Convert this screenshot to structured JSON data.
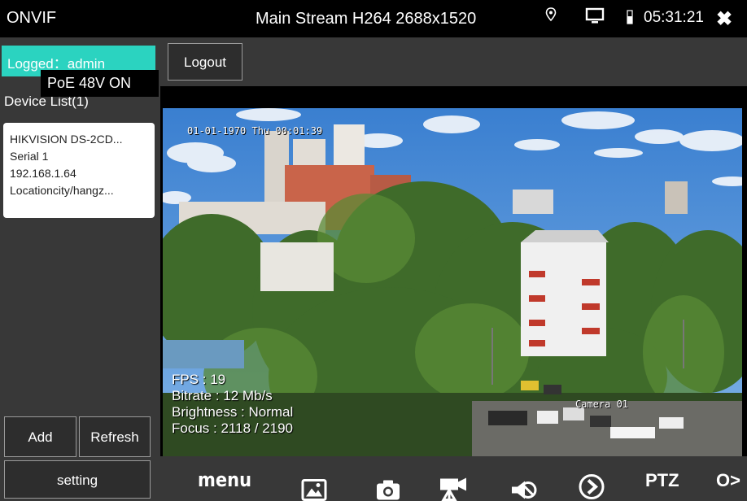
{
  "statusbar": {
    "app_title": "ONVIF",
    "stream_title": "Main Stream H264 2688x1520",
    "time": "05:31:21",
    "close_glyph": "✖",
    "icons": [
      "location-icon",
      "monitor-icon",
      "battery-icon"
    ]
  },
  "sidebar": {
    "logged": "Logged：admin",
    "poe": "PoE 48V ON",
    "device_list_header": "Device List(1)",
    "device": {
      "name": "HIKVISION DS-2CD...",
      "serial": "Serial 1",
      "ip": "192.168.1.64",
      "location": "Locationcity/hangz..."
    },
    "add_label": "Add",
    "refresh_label": "Refresh",
    "setting_label": "setting"
  },
  "mainbar": {
    "logout_label": "Logout"
  },
  "video": {
    "osd_time": "01-01-1970 Thu 00:01:39",
    "osd_camera": "Camera 01",
    "fps": "FPS : 19",
    "bitrate": "Bitrate : 12 Mb/s",
    "brightness": "Brightness : Normal",
    "focus": "Focus : 2118 / 2190"
  },
  "toolbar": {
    "menu_label": "menu",
    "ptz_label": "PTZ",
    "more_label": "O>",
    "icons": [
      "image-icon",
      "camera-icon",
      "video-record-icon",
      "mute-icon",
      "play-icon"
    ]
  },
  "colors": {
    "accent": "#2bd3c0",
    "panel": "#383838",
    "background": "#000000"
  }
}
